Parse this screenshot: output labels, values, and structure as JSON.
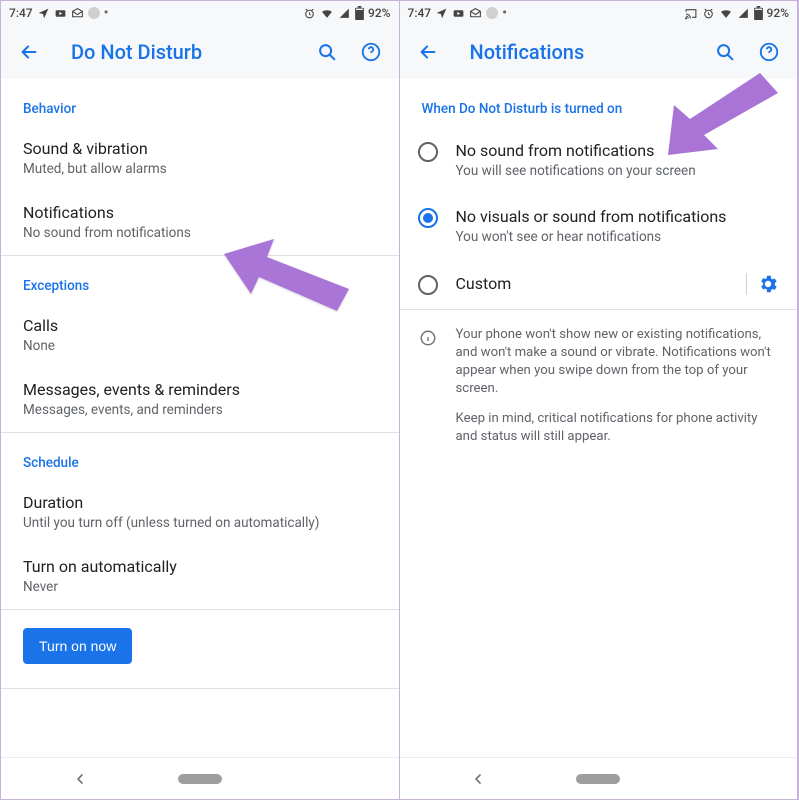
{
  "status": {
    "time": "7:47",
    "battery": "92%"
  },
  "left": {
    "title": "Do Not Disturb",
    "sections": {
      "behavior": {
        "label": "Behavior",
        "items": [
          {
            "title": "Sound & vibration",
            "summary": "Muted, but allow alarms"
          },
          {
            "title": "Notifications",
            "summary": "No sound from notifications"
          }
        ]
      },
      "exceptions": {
        "label": "Exceptions",
        "items": [
          {
            "title": "Calls",
            "summary": "None"
          },
          {
            "title": "Messages, events & reminders",
            "summary": "Messages, events, and reminders"
          }
        ]
      },
      "schedule": {
        "label": "Schedule",
        "items": [
          {
            "title": "Duration",
            "summary": "Until you turn off (unless turned on automatically)"
          },
          {
            "title": "Turn on automatically",
            "summary": "Never"
          }
        ]
      }
    },
    "turn_on_label": "Turn on now"
  },
  "right": {
    "title": "Notifications",
    "section_label": "When Do Not Disturb is turned on",
    "options": [
      {
        "title": "No sound from notifications",
        "summary": "You will see notifications on your screen",
        "selected": false
      },
      {
        "title": "No visuals or sound from notifications",
        "summary": "You won't see or hear notifications",
        "selected": true
      },
      {
        "title": "Custom",
        "summary": "",
        "selected": false
      }
    ],
    "info": {
      "p1": "Your phone won't show new or existing notifications, and won't make a sound or vibrate. Notifications won't appear when you swipe down from the top of your screen.",
      "p2": "Keep in mind, critical notifications for phone activity and status will still appear."
    }
  }
}
